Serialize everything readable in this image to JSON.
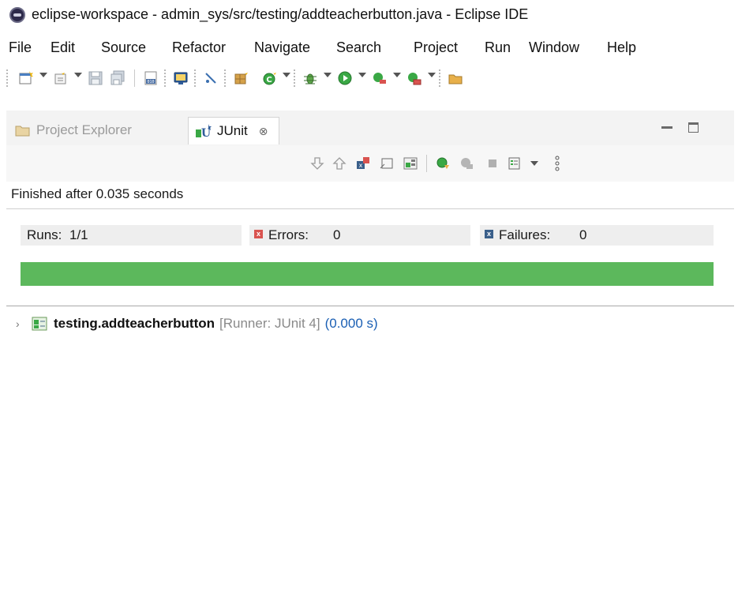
{
  "window": {
    "title": "eclipse-workspace - admin_sys/src/testing/addteacherbutton.java - Eclipse IDE"
  },
  "menubar": {
    "items": [
      "File",
      "Edit",
      "Source",
      "Refactor",
      "Navigate",
      "Search",
      "Project",
      "Run",
      "Window",
      "Help"
    ]
  },
  "tabs": {
    "project_explorer": "Project Explorer",
    "junit": "JUnit",
    "close_glyph": "⊗"
  },
  "junit": {
    "status": "Finished after 0.035 seconds",
    "runs_label": "Runs:",
    "runs_value": "1/1",
    "errors_label": "Errors:",
    "errors_value": "0",
    "failures_label": "Failures:",
    "failures_value": "0",
    "progress": 1.0,
    "progress_color": "#5cb85c",
    "tree": [
      {
        "name": "testing.addteacherbutton",
        "runner": "[Runner: JUnit 4]",
        "duration": "(0.000 s)"
      }
    ]
  },
  "colors": {
    "error_icon": "#d9534f",
    "failure_icon": "#3a5f8a"
  }
}
